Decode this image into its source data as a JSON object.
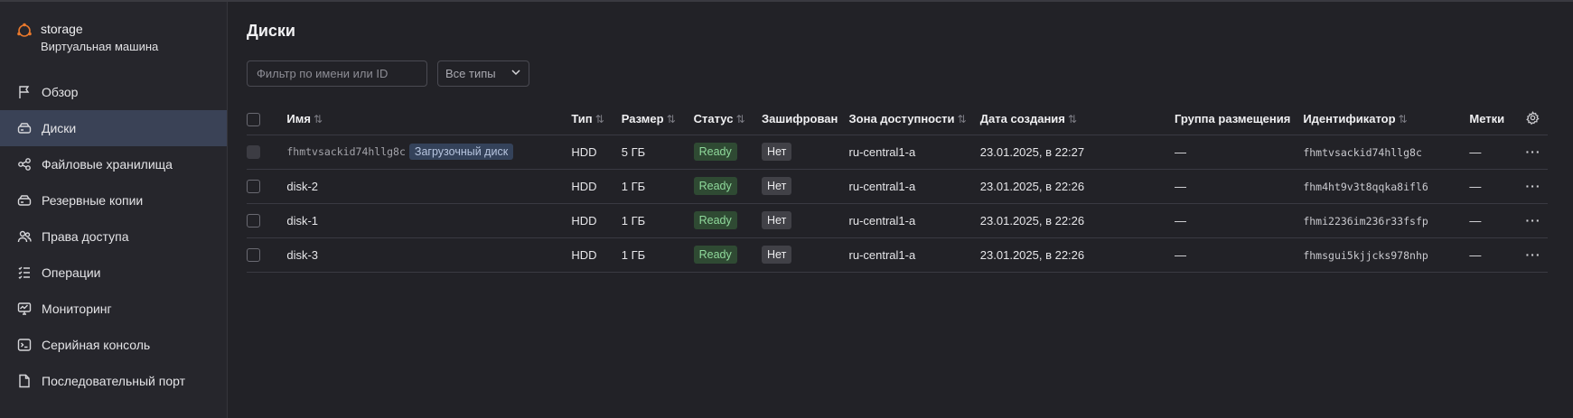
{
  "sidebar": {
    "vm_name": "storage",
    "vm_type": "Виртуальная машина",
    "items": [
      {
        "label": "Обзор",
        "icon": "flag-icon"
      },
      {
        "label": "Диски",
        "icon": "disk-icon",
        "active": true
      },
      {
        "label": "Файловые хранилища",
        "icon": "share-icon"
      },
      {
        "label": "Резервные копии",
        "icon": "backup-icon"
      },
      {
        "label": "Права доступа",
        "icon": "users-icon"
      },
      {
        "label": "Операции",
        "icon": "list-icon"
      },
      {
        "label": "Мониторинг",
        "icon": "monitor-icon"
      },
      {
        "label": "Серийная консоль",
        "icon": "terminal-icon"
      },
      {
        "label": "Последовательный порт",
        "icon": "file-icon"
      }
    ]
  },
  "main": {
    "title": "Диски",
    "filter_placeholder": "Фильтр по имени или ID",
    "type_select": "Все типы",
    "columns": {
      "name": "Имя",
      "type": "Тип",
      "size": "Размер",
      "status": "Статус",
      "encrypted": "Зашифрован",
      "zone": "Зона доступности",
      "created": "Дата создания",
      "group": "Группа размещения",
      "id": "Идентификатор",
      "labels": "Метки"
    },
    "rows": [
      {
        "name": "fhmtvsackid74hllg8c",
        "badge": "Загрузочный диск",
        "type": "HDD",
        "size": "5 ГБ",
        "status": "Ready",
        "encrypted": "Нет",
        "zone": "ru-central1-a",
        "created": "23.01.2025, в 22:27",
        "group": "—",
        "id": "fhmtvsackid74hllg8c",
        "labels": "—"
      },
      {
        "name": "disk-2",
        "type": "HDD",
        "size": "1 ГБ",
        "status": "Ready",
        "encrypted": "Нет",
        "zone": "ru-central1-a",
        "created": "23.01.2025, в 22:26",
        "group": "—",
        "id": "fhm4ht9v3t8qqka8ifl6",
        "labels": "—"
      },
      {
        "name": "disk-1",
        "type": "HDD",
        "size": "1 ГБ",
        "status": "Ready",
        "encrypted": "Нет",
        "zone": "ru-central1-a",
        "created": "23.01.2025, в 22:26",
        "group": "—",
        "id": "fhmi2236im236r33fsfp",
        "labels": "—"
      },
      {
        "name": "disk-3",
        "type": "HDD",
        "size": "1 ГБ",
        "status": "Ready",
        "encrypted": "Нет",
        "zone": "ru-central1-a",
        "created": "23.01.2025, в 22:26",
        "group": "—",
        "id": "fhmsgui5kjjcks978nhp",
        "labels": "—"
      }
    ],
    "row_menu": "···"
  },
  "colors": {
    "background": "#222227",
    "sidebar": "#26262c",
    "active_item": "#3a4256",
    "accent_orange": "#e8782c",
    "ready_bg": "#2f4a33",
    "ready_text": "#8fd99b"
  }
}
